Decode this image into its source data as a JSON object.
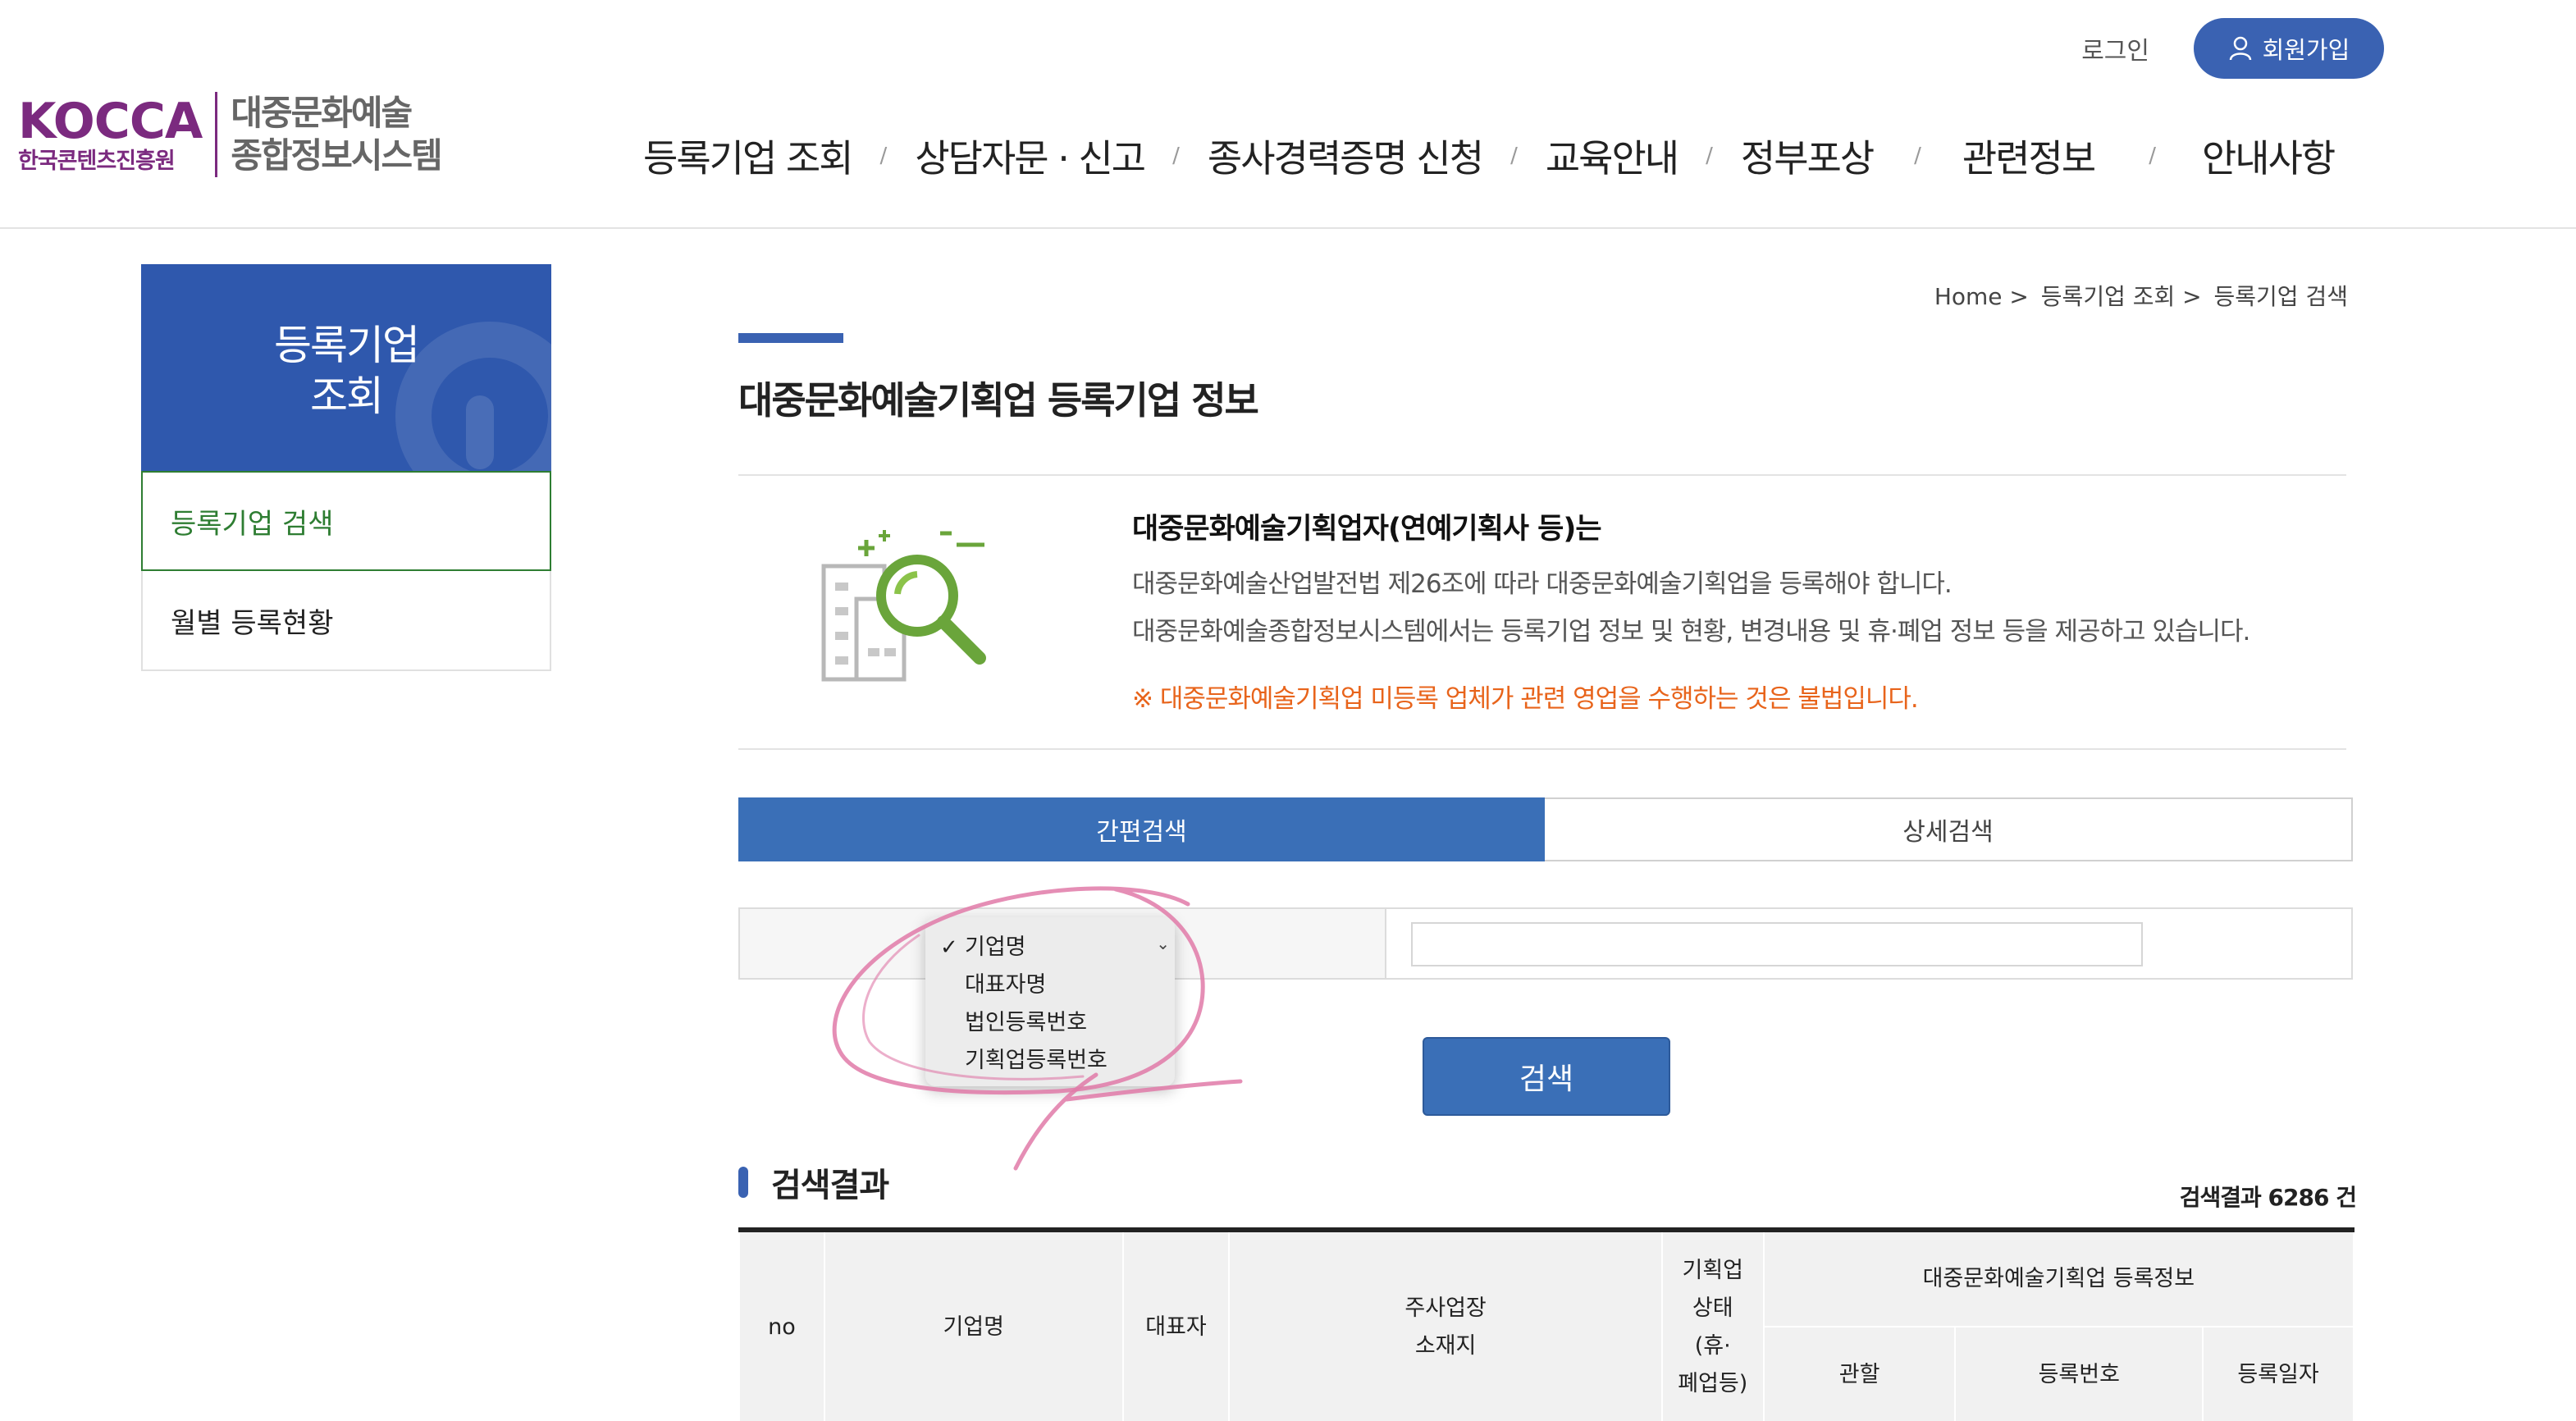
{
  "header": {
    "login": "로그인",
    "join": "회원가입",
    "logo": {
      "mark": "KOCCA",
      "org": "한국콘텐츠진흥원",
      "system_line1": "대중문화예술",
      "system_line2": "종합정보시스템"
    },
    "nav": [
      "등록기업 조회",
      "상담자문 · 신고",
      "종사경력증명 신청",
      "교육안내",
      "정부포상",
      "관련정보",
      "안내사항"
    ],
    "nav_separator": "/"
  },
  "sidebar": {
    "title_line1": "등록기업",
    "title_line2": "조회",
    "items": [
      "등록기업 검색",
      "월별 등록현황"
    ],
    "active_index": 0
  },
  "breadcrumb": [
    "Home >",
    "등록기업 조회 >",
    "등록기업 검색"
  ],
  "page_title": {
    "prefix": "대중문화예술기획업",
    "bold": "등록기업 정보"
  },
  "info": {
    "heading": "대중문화예술기획업자(연예기획사 등)는",
    "line1": "대중문화예술산업발전법 제26조에 따라 대중문화예술기획업을 등록해야 합니다.",
    "line2": "대중문화예술종합정보시스템에서는 등록기업 정보 및 현황, 변경내용 및 휴·폐업 정보 등을 제공하고 있습니다.",
    "warning": "※ 대중문화예술기획업 미등록 업체가 관련 영업을 수행하는 것은 불법입니다."
  },
  "tabs": [
    "간편검색",
    "상세검색"
  ],
  "active_tab": 0,
  "search": {
    "field_options": [
      "기업명",
      "대표자명",
      "법인등록번호",
      "기획업등록번호"
    ],
    "selected_option": "기업명",
    "check_mark": "✓",
    "query": "",
    "button": "검색"
  },
  "results": {
    "title": "검색결과",
    "count_text": "검색결과 6286 건",
    "headers": {
      "no": "no",
      "company": "기업명",
      "representative": "대표자",
      "location_line1": "주사업장",
      "location_line2": "소재지",
      "status_lines": [
        "기획업",
        "상태",
        "(휴·",
        "폐업등)"
      ],
      "registration_group": "대중문화예술기획업 등록정보",
      "jurisdiction": "관할",
      "reg_number": "등록번호",
      "reg_date": "등록일자"
    }
  },
  "colors": {
    "primary_blue": "#3a62b2",
    "tab_blue": "#3a6fb7",
    "active_green": "#2e7d32",
    "warning_orange": "#e8641b",
    "logo_purple": "#7b2a7f",
    "annotation_pink": "#e07aa8"
  }
}
